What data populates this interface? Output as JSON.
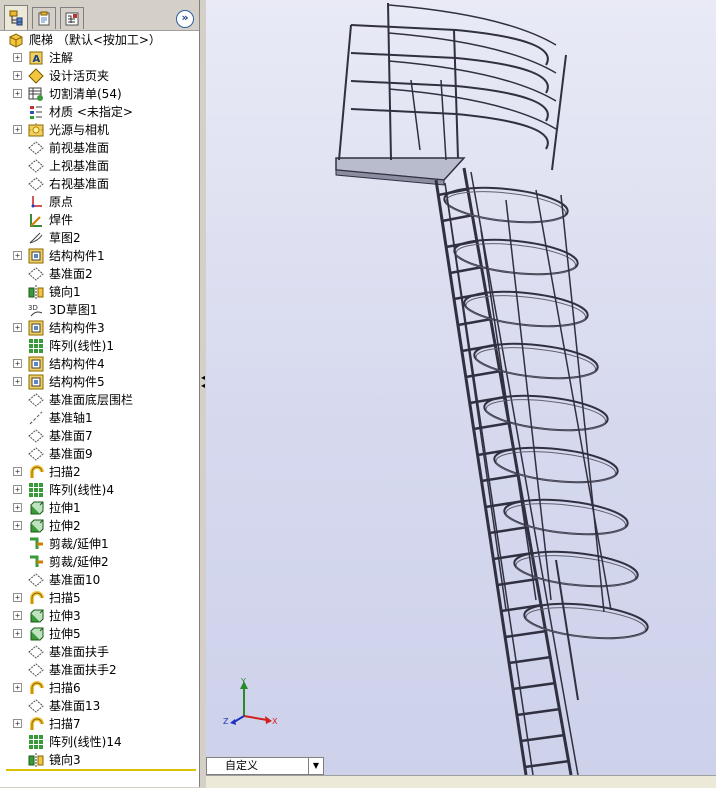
{
  "panel": {
    "tabs": [
      {
        "name": "featuremanager-tab",
        "icon": "feature-tree-icon"
      },
      {
        "name": "propertymanager-tab",
        "icon": "property-sheet-icon"
      },
      {
        "name": "configurationmanager-tab",
        "icon": "configuration-icon"
      }
    ],
    "expand_glyph": "»"
  },
  "tree": {
    "root_label": "爬梯   （默认<按加工>）",
    "items": [
      {
        "label": "注解",
        "icon": "annotations-icon",
        "expand": true
      },
      {
        "label": "设计活页夹",
        "icon": "design-binder-icon",
        "expand": true
      },
      {
        "label": "切割清单(54)",
        "icon": "cut-list-icon",
        "expand": true
      },
      {
        "label": "材质 <未指定>",
        "icon": "material-icon",
        "expand": false
      },
      {
        "label": "光源与相机",
        "icon": "lights-cameras-icon",
        "expand": true
      },
      {
        "label": "前视基准面",
        "icon": "plane-icon",
        "expand": false
      },
      {
        "label": "上视基准面",
        "icon": "plane-icon",
        "expand": false
      },
      {
        "label": "右视基准面",
        "icon": "plane-icon",
        "expand": false
      },
      {
        "label": "原点",
        "icon": "origin-icon",
        "expand": false
      },
      {
        "label": "焊件",
        "icon": "weldment-icon",
        "expand": false
      },
      {
        "label": "草图2",
        "icon": "sketch-icon",
        "expand": false
      },
      {
        "label": "结构构件1",
        "icon": "structural-member-icon",
        "expand": true
      },
      {
        "label": "基准面2",
        "icon": "plane-icon",
        "expand": false
      },
      {
        "label": "镜向1",
        "icon": "mirror-icon",
        "expand": false
      },
      {
        "label": "3D草图1",
        "icon": "3d-sketch-icon",
        "expand": false
      },
      {
        "label": "结构构件3",
        "icon": "structural-member-icon",
        "expand": true
      },
      {
        "label": "阵列(线性)1",
        "icon": "linear-pattern-icon",
        "expand": false
      },
      {
        "label": "结构构件4",
        "icon": "structural-member-icon",
        "expand": true
      },
      {
        "label": "结构构件5",
        "icon": "structural-member-icon",
        "expand": true
      },
      {
        "label": "基准面底层围栏",
        "icon": "plane-icon",
        "expand": false
      },
      {
        "label": "基准轴1",
        "icon": "axis-icon",
        "expand": false
      },
      {
        "label": "基准面7",
        "icon": "plane-icon",
        "expand": false
      },
      {
        "label": "基准面9",
        "icon": "plane-icon",
        "expand": false
      },
      {
        "label": "扫描2",
        "icon": "sweep-icon",
        "expand": true
      },
      {
        "label": "阵列(线性)4",
        "icon": "linear-pattern-icon",
        "expand": true
      },
      {
        "label": "拉伸1",
        "icon": "extrude-icon",
        "expand": true
      },
      {
        "label": "拉伸2",
        "icon": "extrude-icon",
        "expand": true
      },
      {
        "label": "剪裁/延伸1",
        "icon": "trim-extend-icon",
        "expand": false
      },
      {
        "label": "剪裁/延伸2",
        "icon": "trim-extend-icon",
        "expand": false
      },
      {
        "label": "基准面10",
        "icon": "plane-icon",
        "expand": false
      },
      {
        "label": "扫描5",
        "icon": "sweep-icon",
        "expand": true
      },
      {
        "label": "拉伸3",
        "icon": "extrude-icon",
        "expand": true
      },
      {
        "label": "拉伸5",
        "icon": "extrude-icon",
        "expand": true
      },
      {
        "label": "基准面扶手",
        "icon": "plane-icon",
        "expand": false
      },
      {
        "label": "基准面扶手2",
        "icon": "plane-icon",
        "expand": false
      },
      {
        "label": "扫描6",
        "icon": "sweep-icon",
        "expand": true
      },
      {
        "label": "基准面13",
        "icon": "plane-icon",
        "expand": false
      },
      {
        "label": "扫描7",
        "icon": "sweep-icon",
        "expand": true
      },
      {
        "label": "阵列(线性)14",
        "icon": "linear-pattern-icon",
        "expand": false
      },
      {
        "label": "镜向3",
        "icon": "mirror-icon",
        "expand": false
      }
    ]
  },
  "viewport": {
    "view_orientation": "自定义",
    "triad": {
      "x": "X",
      "y": "Y",
      "z": "Z"
    },
    "model_icon": "cage-ladder-model"
  },
  "colors": {
    "panel_bg": "#ffffff",
    "chrome": "#d4d0c8",
    "rollback_bar": "#d9c300",
    "viewport_top": "#e9eaf6",
    "viewport_bottom": "#cdd1ea"
  }
}
